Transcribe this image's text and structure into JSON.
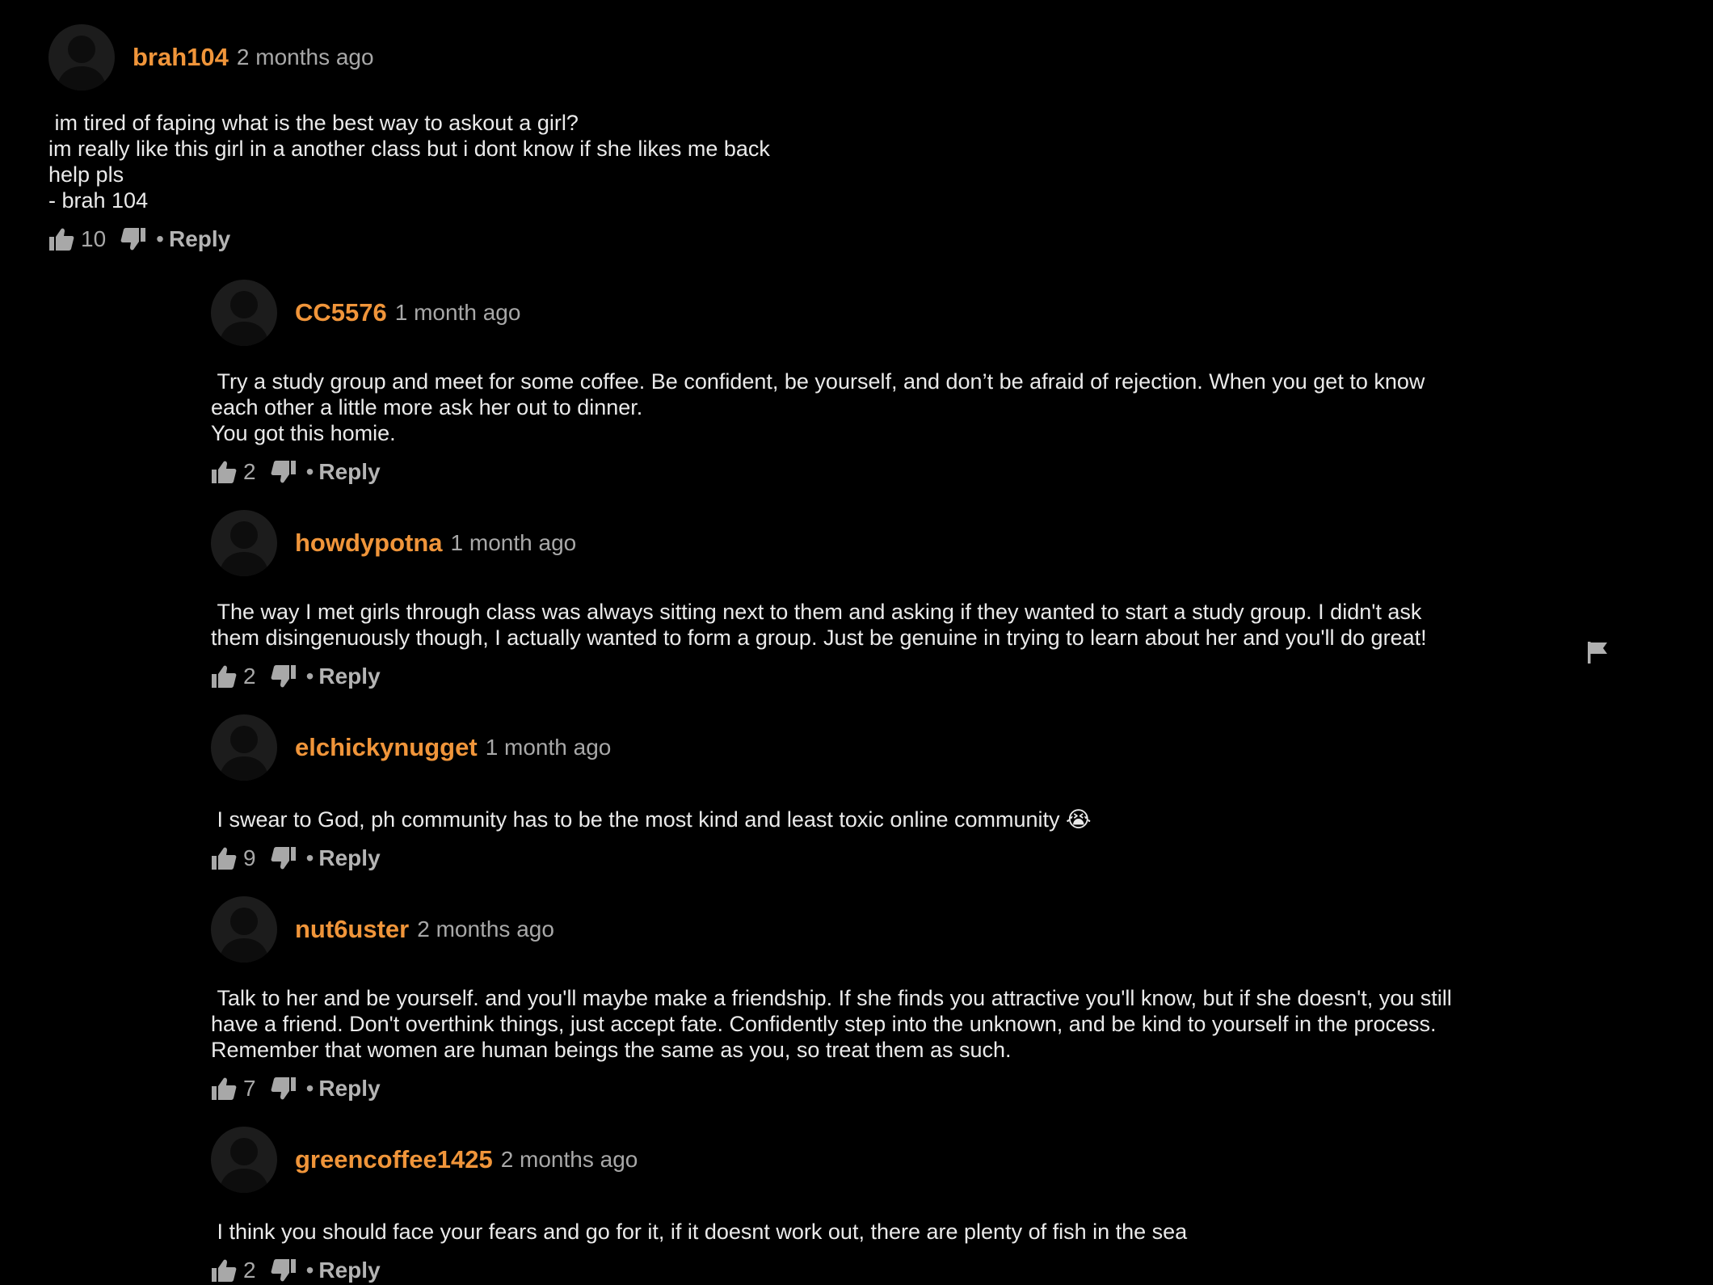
{
  "colors": {
    "background": "#000000",
    "username": "#f0953a",
    "meta": "#a8a8a8",
    "text": "#eaeaea"
  },
  "comments": [
    {
      "username": "brah104",
      "time": "2 months ago",
      "text": " im tired of faping what is the best way to askout a girl?\nim really like this girl in a another class but i dont know if she likes me back\nhelp pls\n- brah 104",
      "likes": "10",
      "reply_label": "Reply"
    },
    {
      "username": "CC5576",
      "time": "1 month ago",
      "text": " Try a study group and meet for some coffee. Be confident, be yourself, and don’t be afraid of rejection. When you get to know\neach other a little more ask her out to dinner.\nYou got this homie.",
      "likes": "2",
      "reply_label": "Reply"
    },
    {
      "username": "howdypotna",
      "time": "1 month ago",
      "text": " The way I met girls through class was always sitting next to them and asking if they wanted to start a study group. I didn't ask\nthem disingenuously though, I actually wanted to form a group. Just be genuine in trying to learn about her and you'll do great!",
      "likes": "2",
      "reply_label": "Reply"
    },
    {
      "username": "elchickynugget",
      "time": "1 month ago",
      "text": " I swear to God, ph community has to be the most kind and least toxic online community 😭",
      "likes": "9",
      "reply_label": "Reply"
    },
    {
      "username": "nut6uster",
      "time": "2 months ago",
      "text": " Talk to her and be yourself. and you'll maybe make a friendship. If she finds you attractive you'll know, but if she doesn't, you still\nhave a friend. Don't overthink things, just accept fate. Confidently step into the unknown, and be kind to yourself in the process.\nRemember that women are human beings the same as you, so treat them as such.",
      "likes": "7",
      "reply_label": "Reply"
    },
    {
      "username": "greencoffee1425",
      "time": "2 months ago",
      "text": " I think you should face your fears and go for it, if it doesnt work out, there are plenty of fish in the sea",
      "likes": "2",
      "reply_label": "Reply"
    }
  ],
  "icons": {
    "avatar": "user-avatar-icon",
    "like": "thumbs-up-icon",
    "dislike": "thumbs-down-icon",
    "flag": "flag-icon"
  },
  "separator": "•"
}
